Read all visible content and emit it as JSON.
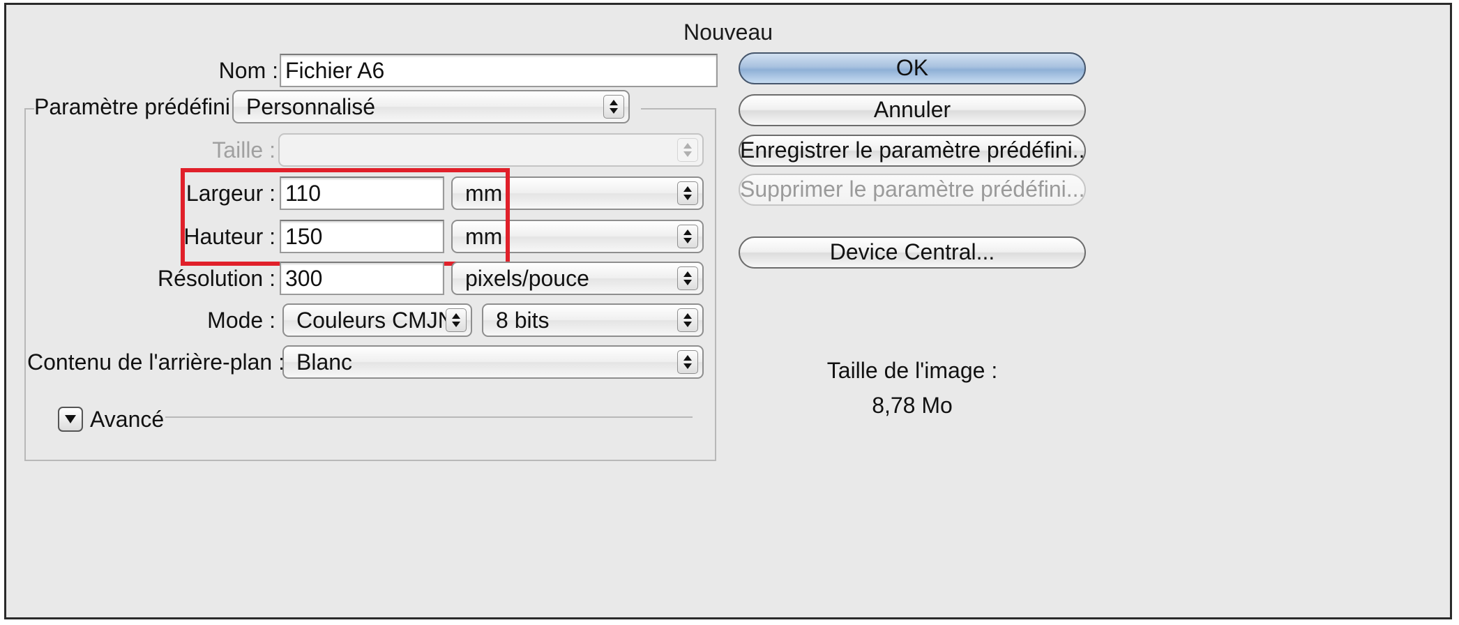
{
  "window": {
    "title": "Nouveau"
  },
  "form": {
    "nom": {
      "label": "Nom :",
      "value": "Fichier A6"
    },
    "preset": {
      "label": "Paramètre prédéfini :",
      "value": "Personnalisé"
    },
    "taille": {
      "label": "Taille :",
      "value": ""
    },
    "largeur": {
      "label": "Largeur :",
      "value": "110",
      "unit": "mm"
    },
    "hauteur": {
      "label": "Hauteur :",
      "value": "150",
      "unit": "mm"
    },
    "resolution": {
      "label": "Résolution :",
      "value": "300",
      "unit": "pixels/pouce"
    },
    "mode": {
      "label": "Mode :",
      "value": "Couleurs CMJN",
      "depth": "8 bits"
    },
    "background": {
      "label": "Contenu de l'arrière-plan :",
      "value": "Blanc"
    },
    "advanced": {
      "label": "Avancé"
    }
  },
  "buttons": {
    "ok": "OK",
    "cancel": "Annuler",
    "save_preset": "Enregistrer le paramètre prédéfini...",
    "delete_preset": "Supprimer le paramètre prédéfini...",
    "device_central": "Device Central..."
  },
  "image_size": {
    "label": "Taille de l'image :",
    "value": "8,78 Mo"
  },
  "colors": {
    "highlight": "#e0202a",
    "default_button": "#a8c1df"
  },
  "icons": {
    "popup_arrows": "up-down-arrows-icon",
    "disclosure": "disclosure-triangle-icon"
  }
}
